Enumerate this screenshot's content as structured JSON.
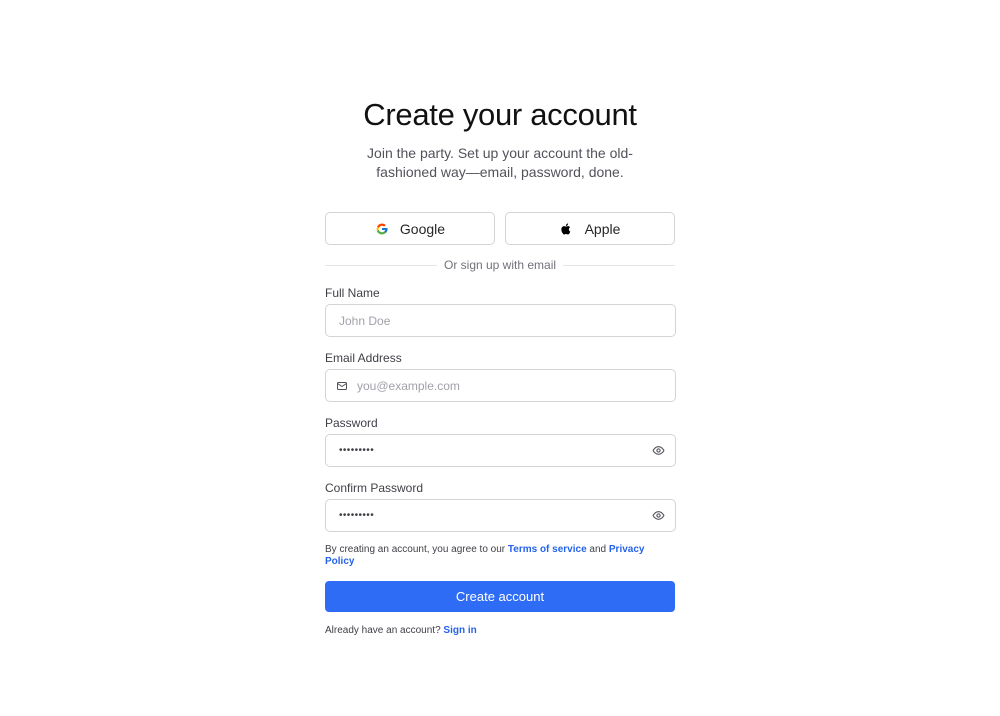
{
  "header": {
    "title": "Create your account",
    "subtitle": "Join the party. Set up your account the old-fashioned way—email, password, done."
  },
  "social": {
    "google_label": "Google",
    "google_icon": "google-g-icon",
    "apple_label": "Apple",
    "apple_icon": "apple-logo-icon"
  },
  "divider_text": "Or sign up with email",
  "form": {
    "full_name": {
      "label": "Full Name",
      "placeholder": "John Doe",
      "value": ""
    },
    "email": {
      "label": "Email Address",
      "placeholder": "you@example.com",
      "value": "",
      "icon": "mail-icon"
    },
    "password": {
      "label": "Password",
      "value": "•••••••••",
      "toggle_icon": "eye-icon"
    },
    "confirm_password": {
      "label": "Confirm Password",
      "value": "•••••••••",
      "toggle_icon": "eye-icon"
    }
  },
  "terms": {
    "prefix": "By creating an account, you agree to our ",
    "terms_link": "Terms of service",
    "conjunction": " and ",
    "privacy_link": "Privacy Policy"
  },
  "submit_label": "Create account",
  "signin": {
    "prompt": "Already have an account? ",
    "link": "Sign in"
  },
  "colors": {
    "primary": "#2f6cf5",
    "link": "#2563eb",
    "border": "#d4d4d8"
  }
}
